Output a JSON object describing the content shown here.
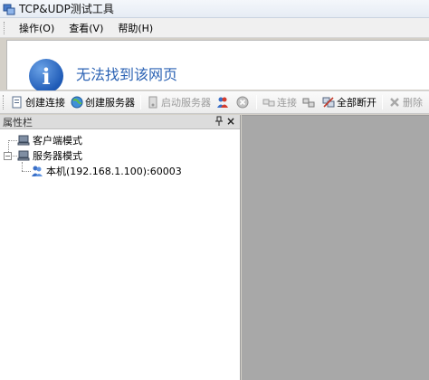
{
  "window": {
    "title": "TCP&UDP测试工具"
  },
  "menu": [
    {
      "label": "操作(O)"
    },
    {
      "label": "查看(V)"
    },
    {
      "label": "帮助(H)"
    }
  ],
  "webview": {
    "message": "无法找到该网页",
    "icon": "info-icon"
  },
  "toolbar": {
    "create_connection": "创建连接",
    "create_server": "创建服务器",
    "start_server": "启动服务器",
    "connect": "连接",
    "disconnect_all": "全部断开",
    "delete": "删除"
  },
  "panel": {
    "title": "属性栏",
    "pin_glyph": "ꟷ",
    "close_glyph": "×",
    "tree": {
      "client_mode": "客户端模式",
      "server_mode": "服务器模式",
      "local_server": "本机(192.168.1.100):60003"
    }
  },
  "colors": {
    "accent": "#2c63b4",
    "content_bg": "#a8a8a8"
  }
}
